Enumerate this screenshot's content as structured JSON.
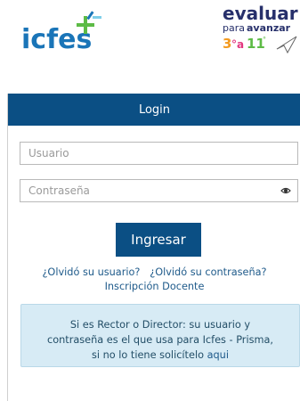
{
  "header": {
    "logo_left_text": "icfes",
    "logo_right": {
      "line1": "evaluar",
      "line2_a": "para",
      "line2_b": "avanzar",
      "line3_a": "3",
      "line3_b": "°a",
      "line3_c": "11",
      "line3_d": "°"
    }
  },
  "login": {
    "title": "Login",
    "username_placeholder": "Usuario",
    "password_placeholder": "Contraseña",
    "submit_label": "Ingresar",
    "forgot_user": "¿Olvidó su usuario?",
    "forgot_password": "¿Olvidó su contraseña?",
    "teacher_signup": "Inscripción Docente"
  },
  "notice": {
    "text_line1": "Si es Rector o Director: su usuario y",
    "text_line2": "contraseña es el que usa para Icfes - Prisma,",
    "text_line3_pre": "si no lo tiene solicítelo ",
    "link": "aqui"
  },
  "colors": {
    "primary": "#0b4f84",
    "link": "#1e5a8a",
    "notice_bg": "#d7ebf5",
    "icfes_blue": "#1a75b8",
    "icfes_green": "#5dbb46",
    "evaluar_navy": "#27306b",
    "evaluar_orange": "#f39a1f"
  },
  "icons": [
    "show-password-icon",
    "icfes-logo",
    "evaluar-para-avanzar-logo"
  ]
}
